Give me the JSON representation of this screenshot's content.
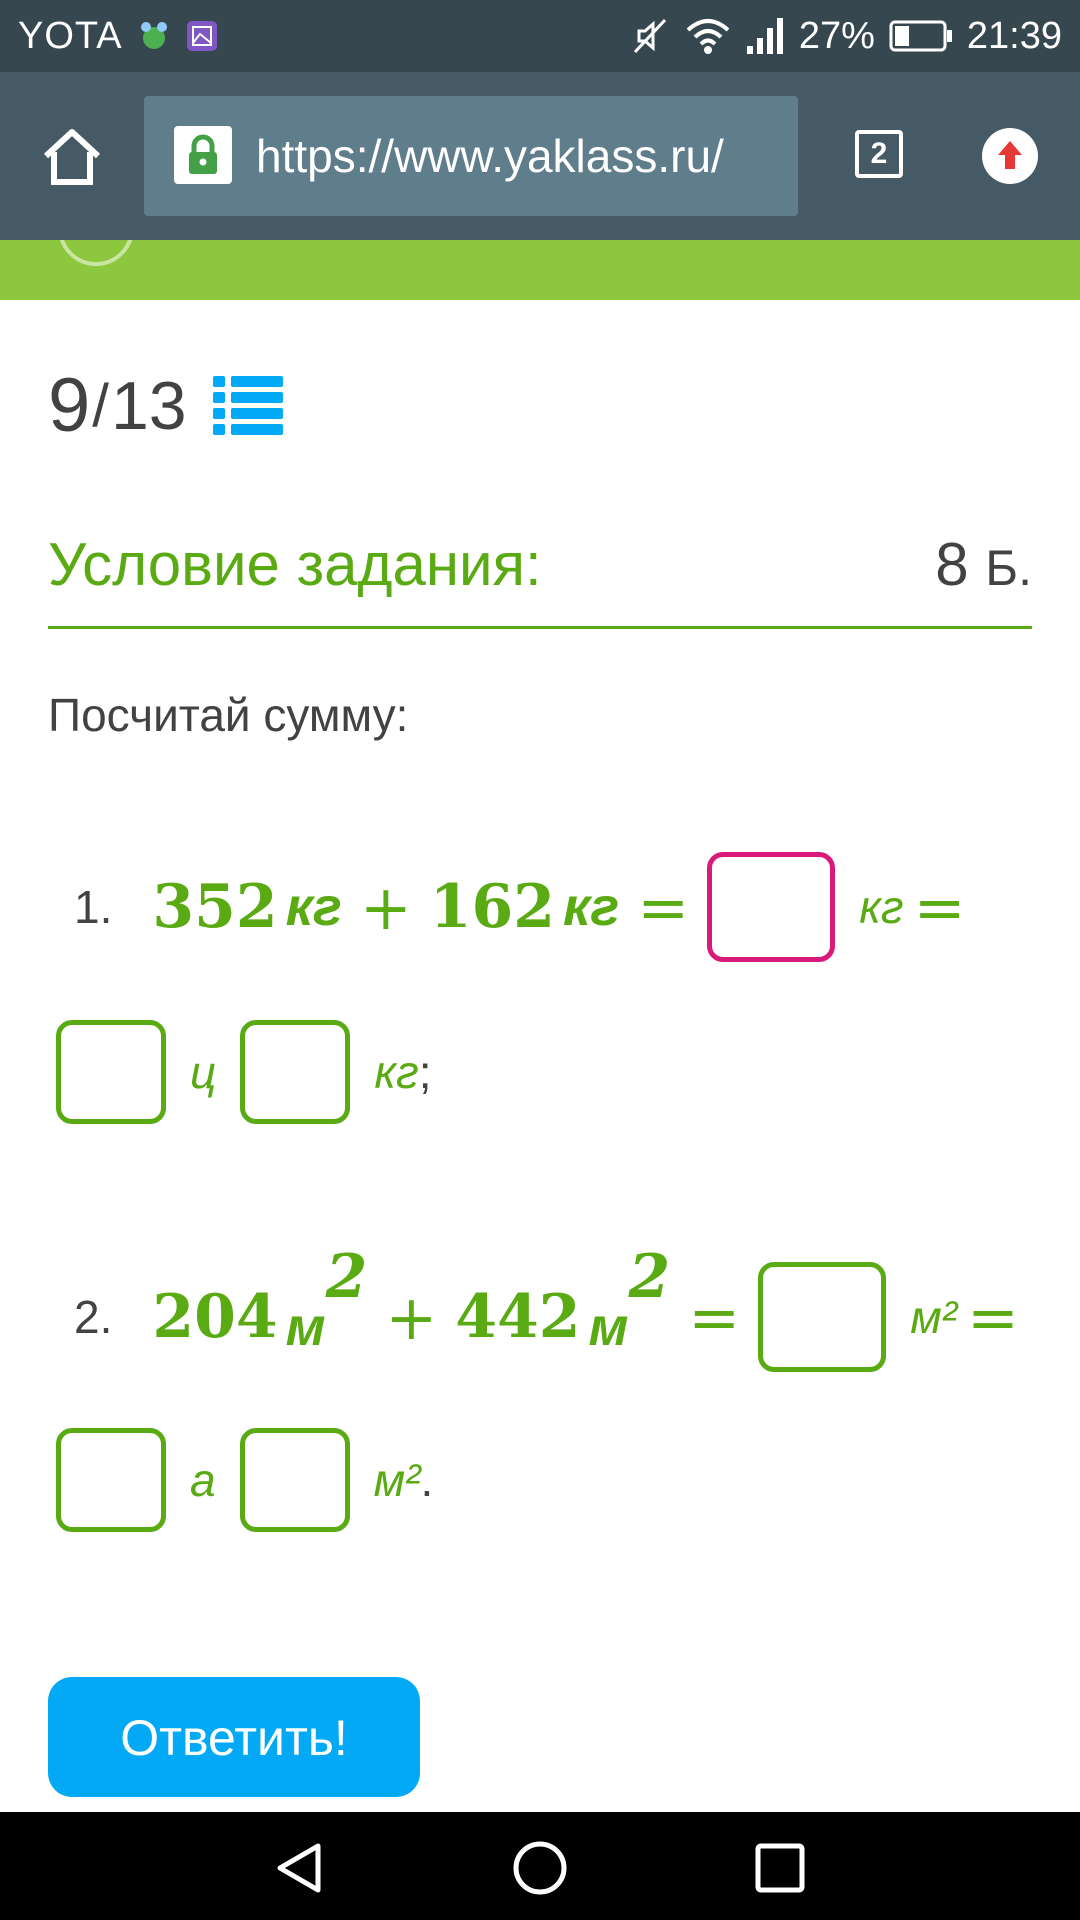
{
  "status_bar": {
    "carrier": "YOTA",
    "battery": "27%",
    "time": "21:39"
  },
  "browser": {
    "url": "https://www.yaklass.ru/",
    "tab_count": "2"
  },
  "task": {
    "counter_current": "9",
    "counter_separator": "/",
    "counter_total": "13",
    "condition_title": "Условие задания:",
    "points_value": "8",
    "points_unit": "Б.",
    "instruction": "Посчитай сумму:",
    "problem1": {
      "number": "1.",
      "a": "352",
      "a_unit": "кг",
      "plus": "+",
      "b": "162",
      "b_unit": "кг",
      "eq": "=",
      "result_unit": "кг",
      "eq2": "=",
      "unit_big": "ц",
      "unit_small": "кг",
      "punct": ";"
    },
    "problem2": {
      "number": "2.",
      "a": "204",
      "a_unit": "м",
      "a_exp": "2",
      "plus": "+",
      "b": "442",
      "b_unit": "м",
      "b_exp": "2",
      "eq": "=",
      "result_unit": "м²",
      "eq2": "=",
      "unit_big": "а",
      "unit_small": "м²",
      "punct": "."
    },
    "answer_button": "Ответить!"
  },
  "colors": {
    "green_text": "#5aaa14",
    "green_bar": "#8dc63f",
    "active_box": "#d81b7a",
    "button_blue": "#03a9f4",
    "toolbar": "#455a64",
    "status_bar": "#37474f"
  }
}
